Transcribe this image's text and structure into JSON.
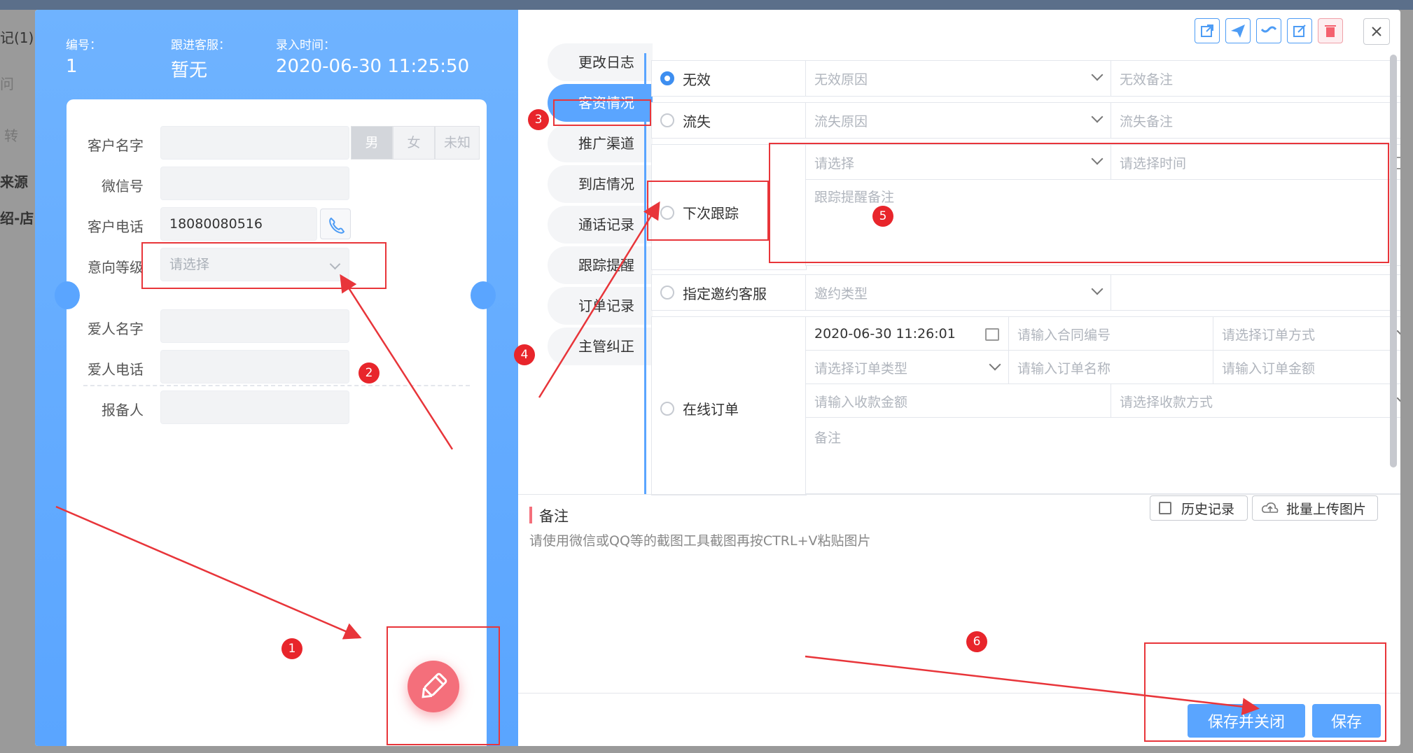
{
  "background": {
    "crumb": "记(1)",
    "text1": "问",
    "text2": "转",
    "col_source": "来源",
    "row_source": "绍-店"
  },
  "header": {
    "id_label": "编号：",
    "id_value": "1",
    "follow_label": "跟进客服：",
    "follow_value": "暂无",
    "time_label": "录入时间：",
    "time_value": "2020-06-30 11:25:50"
  },
  "form": {
    "customer_name_label": "客户名字",
    "gender": [
      "男",
      "女",
      "未知"
    ],
    "wechat_label": "微信号",
    "phone_label": "客户电话",
    "phone_value": "18080080516",
    "intent_label": "意向等级",
    "intent_placeholder": "请选择",
    "partner_name_label": "爱人名字",
    "partner_phone_label": "爱人电话",
    "reporter_label": "报备人"
  },
  "tabs": [
    {
      "label": "更改日志"
    },
    {
      "label": "客资情况"
    },
    {
      "label": "推广渠道"
    },
    {
      "label": "到店情况"
    },
    {
      "label": "通话记录"
    },
    {
      "label": "跟踪提醒"
    },
    {
      "label": "订单记录"
    },
    {
      "label": "主管纠正"
    }
  ],
  "status": {
    "invalid_label": "无效",
    "invalid_reason_ph": "无效原因",
    "invalid_note_ph": "无效备注",
    "lost_label": "流失",
    "lost_reason_ph": "流失原因",
    "lost_note_ph": "流失备注",
    "next_follow_label": "下次跟踪",
    "next_select_ph": "请选择",
    "next_time_ph": "请选择时间",
    "next_note_ph": "跟踪提醒备注",
    "assign_label": "指定邀约客服",
    "invite_type_ph": "邀约类型",
    "online_order_label": "在线订单",
    "order_date": "2020-06-30 11:26:01",
    "contract_no_ph": "请输入合同编号",
    "order_method_ph": "请选择订单方式",
    "order_type_ph": "请选择订单类型",
    "order_name_ph": "请输入订单名称",
    "order_amount_ph": "请输入订单金额",
    "receipt_amount_ph": "请输入收款金额",
    "receipt_method_ph": "请选择收款方式",
    "remark_ph": "备注"
  },
  "notes": {
    "title": "备注",
    "hint": "请使用微信或QQ等的截图工具截图再按CTRL+V粘贴图片",
    "history_btn": "历史记录",
    "upload_btn": "批量上传图片"
  },
  "footer": {
    "save_close": "保存并关闭",
    "save": "保存"
  },
  "annotations": [
    "1",
    "2",
    "3",
    "4",
    "5",
    "6"
  ],
  "colors": {
    "primary": "#5aa5ff",
    "accent_red": "#e8353a",
    "fab": "#f46f7b"
  }
}
